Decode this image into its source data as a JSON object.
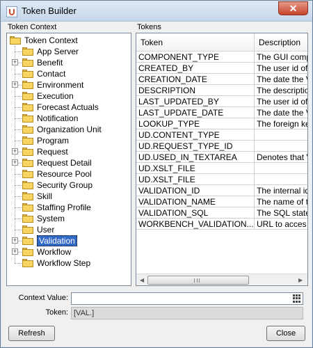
{
  "window": {
    "title": "Token Builder",
    "close_glyph": "✕"
  },
  "tree": {
    "label": "Token Context",
    "root": "Token Context",
    "items": [
      {
        "label": "App Server",
        "expandable": false
      },
      {
        "label": "Benefit",
        "expandable": true
      },
      {
        "label": "Contact",
        "expandable": false
      },
      {
        "label": "Environment",
        "expandable": true
      },
      {
        "label": "Execution",
        "expandable": false
      },
      {
        "label": "Forecast Actuals",
        "expandable": false
      },
      {
        "label": "Notification",
        "expandable": false
      },
      {
        "label": "Organization Unit",
        "expandable": false
      },
      {
        "label": "Program",
        "expandable": false
      },
      {
        "label": "Request",
        "expandable": true
      },
      {
        "label": "Request Detail",
        "expandable": true
      },
      {
        "label": "Resource Pool",
        "expandable": false
      },
      {
        "label": "Security Group",
        "expandable": false
      },
      {
        "label": "Skill",
        "expandable": false
      },
      {
        "label": "Staffing Profile",
        "expandable": false
      },
      {
        "label": "System",
        "expandable": false
      },
      {
        "label": "User",
        "expandable": false
      },
      {
        "label": "Validation",
        "expandable": true,
        "selected": true
      },
      {
        "label": "Workflow",
        "expandable": true
      },
      {
        "label": "Workflow Step",
        "expandable": false
      }
    ]
  },
  "tokens": {
    "label": "Tokens",
    "columns": [
      "Token",
      "Description"
    ],
    "rows": [
      [
        "COMPONENT_TYPE",
        "The GUI comp"
      ],
      [
        "CREATED_BY",
        "The user id of"
      ],
      [
        "CREATION_DATE",
        "The date the V"
      ],
      [
        "DESCRIPTION",
        "The descriptio"
      ],
      [
        "LAST_UPDATED_BY",
        "The user id of"
      ],
      [
        "LAST_UPDATE_DATE",
        "The date the V"
      ],
      [
        "LOOKUP_TYPE",
        "The foreign ke"
      ],
      [
        "UD.CONTENT_TYPE",
        ""
      ],
      [
        "UD.REQUEST_TYPE_ID",
        ""
      ],
      [
        "UD.USED_IN_TEXTAREA",
        "Denotes that V"
      ],
      [
        "UD.XSLT_FILE",
        ""
      ],
      [
        "UD.XSLT_FILE",
        ""
      ],
      [
        "VALIDATION_ID",
        "The internal id"
      ],
      [
        "VALIDATION_NAME",
        "The name of t"
      ],
      [
        "VALIDATION_SQL",
        "The SQL state"
      ],
      [
        "WORKBENCH_VALIDATION...",
        "URL to acces"
      ]
    ]
  },
  "fields": {
    "context_value_label": "Context Value:",
    "context_value": "",
    "token_label": "Token:",
    "token_value": "[VAL.]"
  },
  "buttons": {
    "refresh": "Refresh",
    "close": "Close"
  },
  "icons": {
    "app": "java-cup-icon",
    "folder": "folder-icon",
    "picker": "table-picker-icon",
    "scroll_left": "◀",
    "scroll_right": "▶"
  }
}
